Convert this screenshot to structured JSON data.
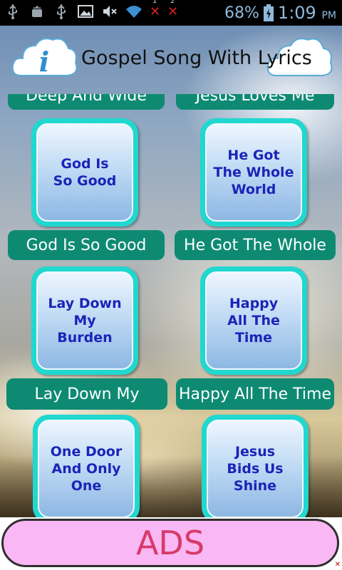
{
  "status_bar": {
    "battery_percent": "68%",
    "time": "1:09",
    "ampm": "PM",
    "notif_count_1": "1",
    "notif_count_2": "2"
  },
  "header": {
    "title": "Gospel Song With Lyrics",
    "info_glyph": "i"
  },
  "partial_labels": {
    "left": "Deep And Wide",
    "right": "Jesus Loves Me"
  },
  "songs": [
    {
      "tile": "God Is\nSo Good",
      "label": "God Is So Good"
    },
    {
      "tile": "He Got\nThe Whole\nWorld",
      "label": "He  Got The Whole"
    },
    {
      "tile": "Lay Down\nMy\nBurden",
      "label": "Lay Down My"
    },
    {
      "tile": "Happy\nAll The\nTime",
      "label": "Happy All The Time"
    },
    {
      "tile": "One Door\nAnd Only\nOne",
      "label": ""
    },
    {
      "tile": "Jesus\nBids Us\nShine",
      "label": ""
    }
  ],
  "ads": {
    "label": "ADS"
  },
  "colors": {
    "label_bg": "#0e8a73",
    "tile_frame": "#20d8cf",
    "tile_text": "#1b24b8",
    "ads_bg": "#f9b7f3",
    "ads_text": "#d63a6a"
  }
}
